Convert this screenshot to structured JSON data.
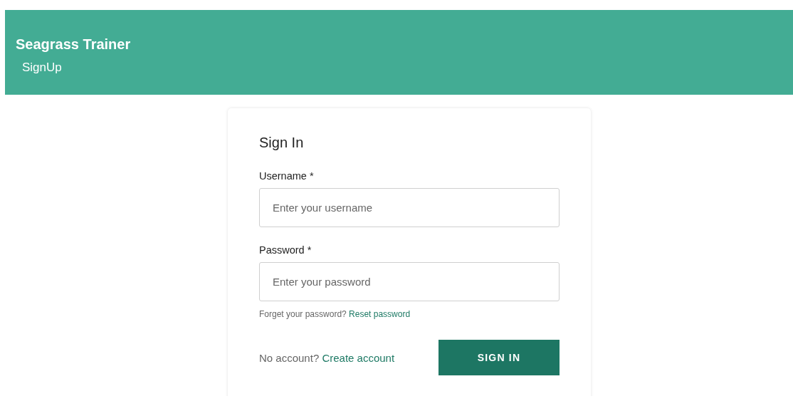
{
  "header": {
    "title": "Seagrass Trainer",
    "nav": [
      "SignUp"
    ]
  },
  "form": {
    "title": "Sign In",
    "fields": [
      {
        "label": "Username *",
        "placeholder": "Enter your username"
      },
      {
        "label": "Password *",
        "placeholder": "Enter your password"
      }
    ],
    "reset": {
      "text": "Forget your password?",
      "link": "Reset password"
    },
    "signup": {
      "text": "No account?",
      "link": "Create account"
    },
    "submit": "SIGN IN"
  }
}
